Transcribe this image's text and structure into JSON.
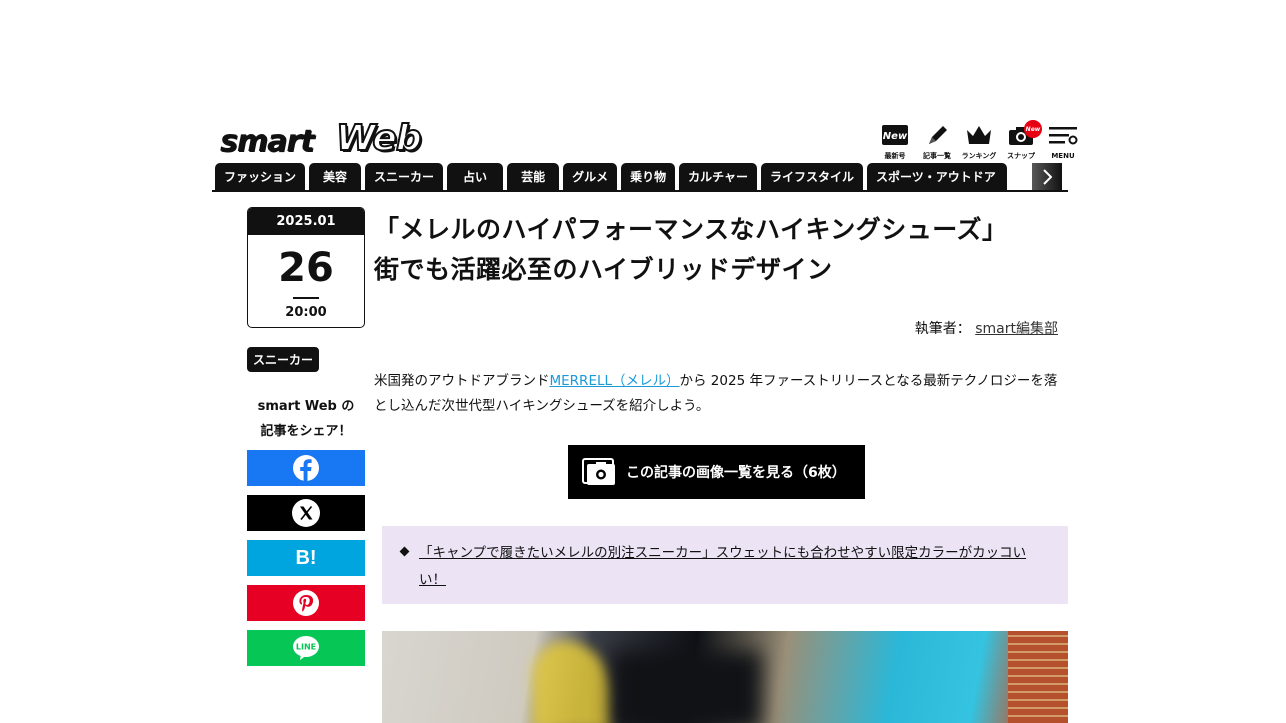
{
  "header": {
    "logo_smart": "smart",
    "logo_web": "Web",
    "utility": [
      {
        "label": "最新号",
        "icon": "new-issue-icon",
        "badge": "New"
      },
      {
        "label": "記事一覧",
        "icon": "pen-icon"
      },
      {
        "label": "ランキング",
        "icon": "crown-icon"
      },
      {
        "label": "スナップ",
        "icon": "camera-icon",
        "badge": "New"
      },
      {
        "label": "MENU",
        "icon": "menu-search-icon"
      }
    ]
  },
  "nav": {
    "tabs": [
      "ファッション",
      "美容",
      "スニーカー",
      "占い",
      "芸能",
      "グルメ",
      "乗り物",
      "カルチャー",
      "ライフスタイル",
      "スポーツ・アウトドア"
    ],
    "next_icon": "chevron-right-icon"
  },
  "date": {
    "year_month": "2025.01",
    "day": "26",
    "time": "20:00"
  },
  "category": "スニーカー",
  "share": {
    "line1": "smart Web の",
    "line2": "記事をシェア！",
    "hatena_label": "B!",
    "line_label": "LINE"
  },
  "article": {
    "title_line1": "「メレルのハイパフォーマンスなハイキングシューズ」",
    "title_line2": "街でも活躍必至のハイブリッドデザイン",
    "author_label": "執筆者：",
    "author_name": "smart編集部",
    "lead_before": "米国発のアウトドアブランド",
    "lead_link": "MERRELL（メレル）",
    "lead_after": "から 2025 年ファーストリリースとなる最新テクノロジーを落とし込んだ次世代型ハイキングシューズを紹介しよう。",
    "gallery_button": "この記事の画像一覧を見る（6枚）",
    "related_link": "「キャンプで履きたいメレルの別注スニーカー」スウェットにも合わせやすい限定カラーがカッコいい！"
  },
  "colors": {
    "facebook": "#1877f2",
    "x": "#000000",
    "hatena": "#00a4de",
    "pinterest": "#e60023",
    "line": "#06c755",
    "related_bg": "#ece4f5",
    "link": "#1b9ad7"
  }
}
